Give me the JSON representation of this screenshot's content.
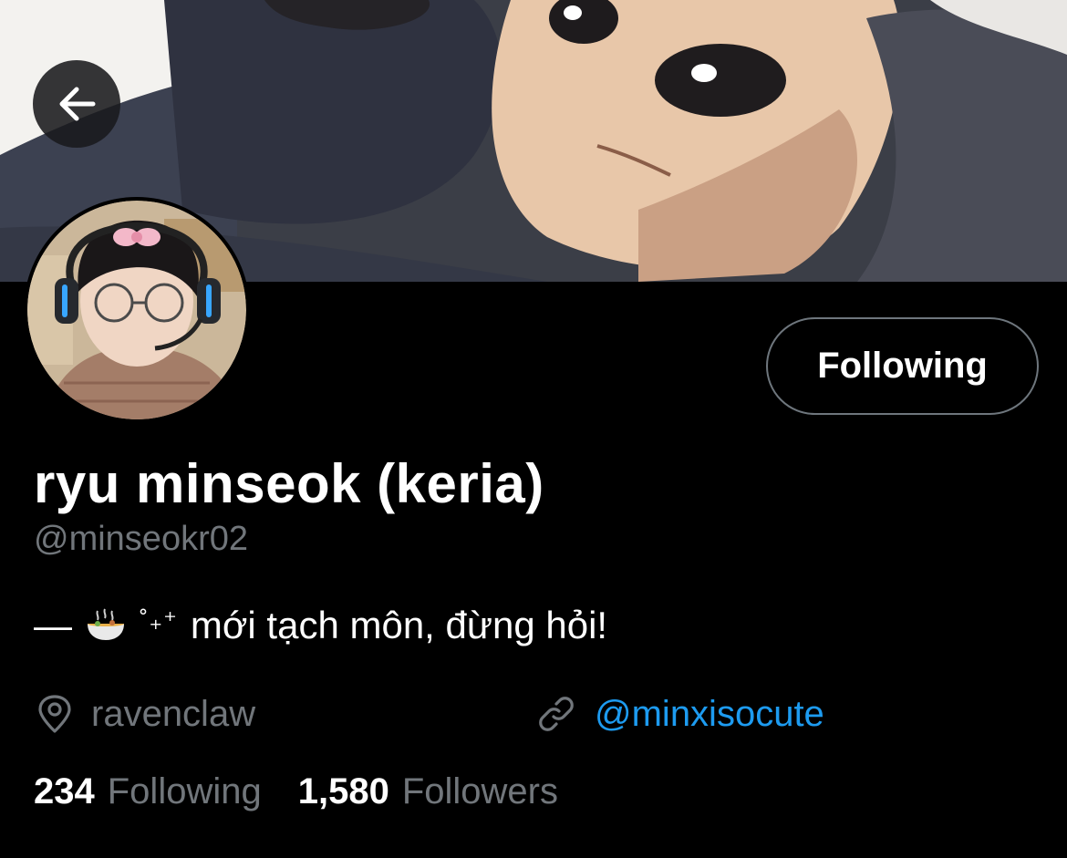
{
  "profile": {
    "display_name": "ryu minseok (keria)",
    "handle": "@minseokr02",
    "bio": {
      "dash": "—",
      "sparkle": "˚₊⁺",
      "text": "mới tạch môn, đừng hỏi!"
    },
    "location": "ravenclaw",
    "link": "@minxisocute",
    "stats": {
      "following_count": "234",
      "following_label": "Following",
      "followers_count": "1,580",
      "followers_label": "Followers"
    }
  },
  "actions": {
    "follow_state_label": "Following"
  },
  "icons": {
    "back": "arrow-left-icon",
    "location": "map-pin-icon",
    "link": "link-icon",
    "bio_emoji": "noodle-bowl-icon"
  },
  "colors": {
    "background": "#000000",
    "text_primary": "#ffffff",
    "text_secondary": "#71767b",
    "link": "#1d9bf0",
    "button_border": "#6e767d"
  }
}
